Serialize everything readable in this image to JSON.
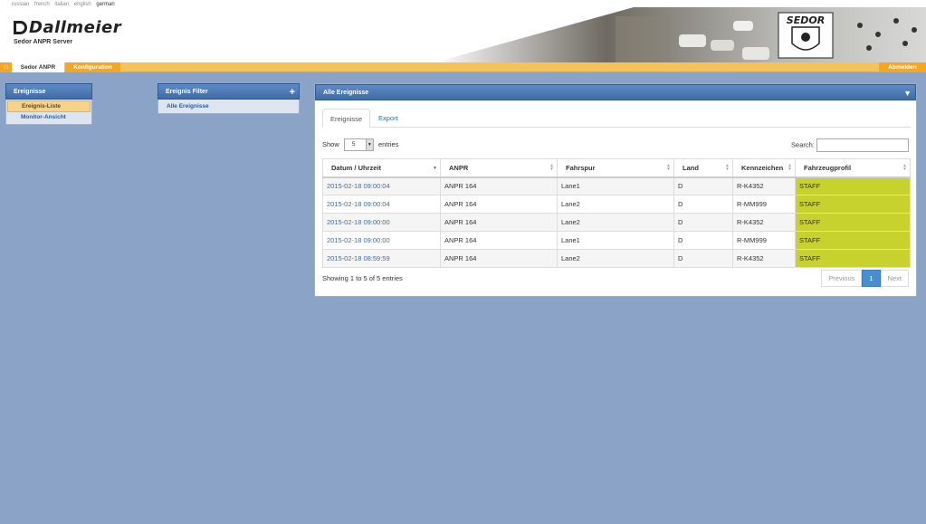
{
  "header": {
    "languages": [
      "russian",
      "french",
      "italian",
      "english",
      "german"
    ],
    "active_language": "german",
    "logo_text": "Dallmeier",
    "subtitle": "Sedor ANPR Server",
    "banner_brand": "SEDOR"
  },
  "navbar": {
    "home_icon": "home-icon",
    "items": [
      "Sedor ANPR",
      "Konfiguration"
    ],
    "logout_label": "Abmelden"
  },
  "sidebar": {
    "title": "Ereignisse",
    "items": [
      {
        "label": "Ereignis-Liste",
        "active": true
      },
      {
        "label": "Monitor-Ansicht",
        "active": false
      }
    ]
  },
  "filter_panel": {
    "title": "Ereignis Filter",
    "items": [
      "Alle Ereignisse"
    ]
  },
  "main": {
    "title": "Alle Ereignisse",
    "tabs": [
      "Ereignisse",
      "Export"
    ],
    "show_label": "Show",
    "page_size": "5",
    "entries_label": "entries",
    "search_label": "Search:",
    "columns": [
      "Datum / Uhrzeit",
      "ANPR",
      "Fahrspur",
      "Land",
      "Kennzeichen",
      "Fahrzeugprofil"
    ],
    "rows": [
      [
        "2015-02-18 09:00:04",
        "ANPR 164",
        "Lane1",
        "D",
        "R-K4352",
        "STAFF"
      ],
      [
        "2015-02-18 09:00:04",
        "ANPR 164",
        "Lane2",
        "D",
        "R-MM999",
        "STAFF"
      ],
      [
        "2015-02-18 09:00:00",
        "ANPR 164",
        "Lane2",
        "D",
        "R-K4352",
        "STAFF"
      ],
      [
        "2015-02-18 09:00:00",
        "ANPR 164",
        "Lane1",
        "D",
        "R-MM999",
        "STAFF"
      ],
      [
        "2015-02-18 08:59:59",
        "ANPR 164",
        "Lane2",
        "D",
        "R-K4352",
        "STAFF"
      ]
    ],
    "info": "Showing 1 to 5 of 5 entries",
    "pager": {
      "previous": "Previous",
      "current": "1",
      "next": "Next"
    }
  },
  "colors": {
    "accent": "#f5a623",
    "panel_header": "#3f6ba8",
    "profile_highlight": "#c8d22e",
    "background": "#8aa3c6"
  }
}
